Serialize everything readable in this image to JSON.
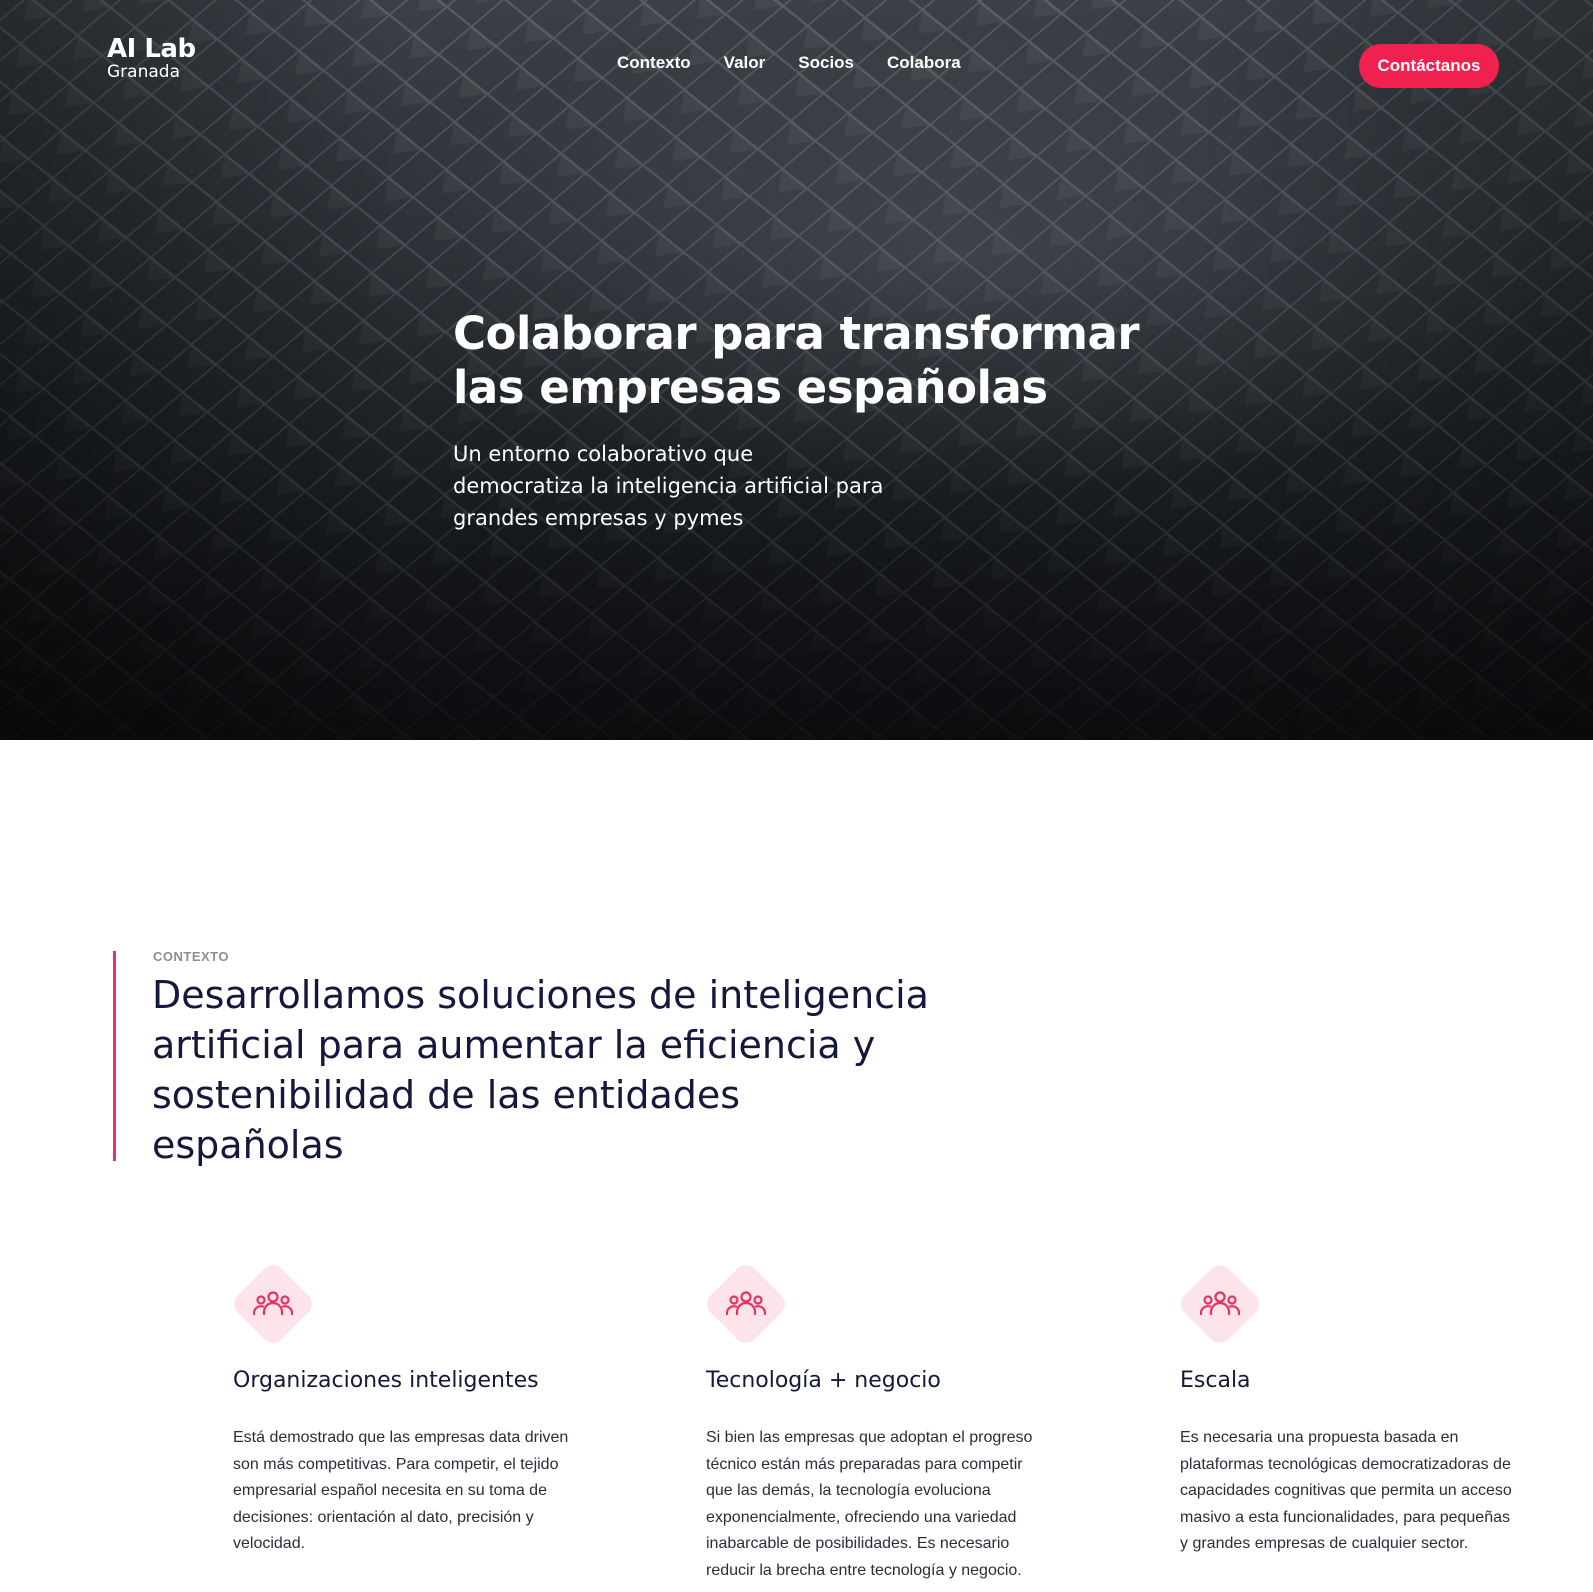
{
  "header": {
    "logo_title": "AI Lab",
    "logo_subtitle": "Granada",
    "nav": [
      "Contexto",
      "Valor",
      "Socios",
      "Colabora"
    ],
    "cta_label": "Contáctanos"
  },
  "hero": {
    "title": "Colaborar para transformar\nlas empresas españolas",
    "subtitle": "Un entorno colaborativo que\ndemocratiza la inteligencia artificial para\ngrandes empresas y pymes"
  },
  "context": {
    "eyebrow": "CONTEXTO",
    "heading": "Desarrollamos soluciones de inteligencia\nartificial para aumentar la eficiencia y\nsostenibilidad de las entidades\nespañolas"
  },
  "features": [
    {
      "icon": "team-icon",
      "title": "Organizaciones inteligentes",
      "text": "Está demostrado que las empresas data driven\nson más competitivas. Para competir, el tejido\nempresarial español necesita en su toma de\ndecisiones: orientación al dato, precisión y\nvelocidad."
    },
    {
      "icon": "team-icon",
      "title": "Tecnología + negocio",
      "text": "Si bien las empresas que adoptan el progreso\ntécnico están más preparadas para competir\nque las demás, la tecnología evoluciona\nexponencialmente, ofreciendo una variedad\ninabarcable de posibilidades. Es necesario\nreducir la brecha entre tecnología y negocio."
    },
    {
      "icon": "team-icon",
      "title": "Escala",
      "text": "Es necesaria una propuesta basada en\nplataformas tecnológicas democratizadoras de\ncapacidades cognitivas que permita un acceso\nmasivo a esta funcionalidades, para pequeñas\ny grandes empresas de cualquier sector."
    }
  ],
  "colors": {
    "accent": "#f0204f",
    "heading": "#14183a",
    "icon_bg": "#fde3ea"
  }
}
